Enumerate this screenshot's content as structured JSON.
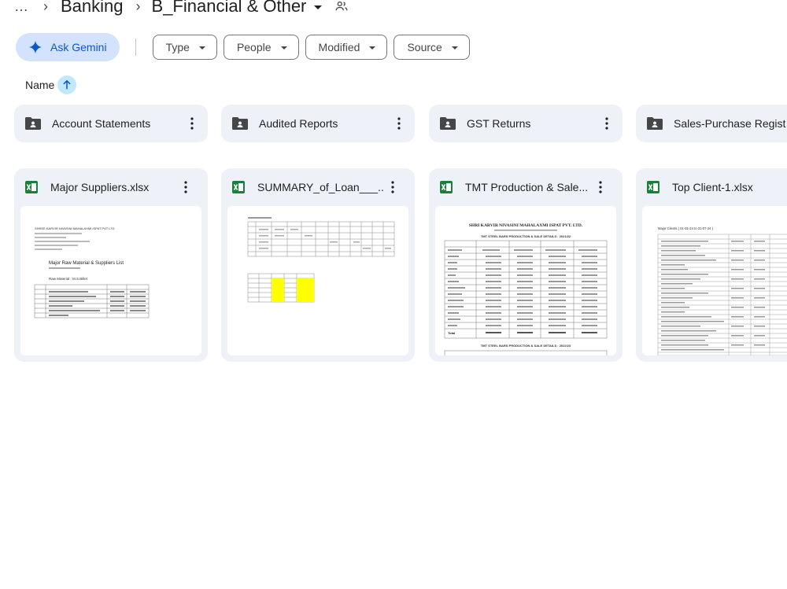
{
  "breadcrumb": {
    "more": "…",
    "items": [
      "Banking",
      "B_Financial & Other"
    ]
  },
  "filters": {
    "gemini_label": "Ask Gemini",
    "chips": [
      "Type",
      "People",
      "Modified",
      "Source"
    ]
  },
  "sort": {
    "label": "Name",
    "direction_icon": "arrow-up-icon"
  },
  "folders": [
    {
      "name": "Account Statements"
    },
    {
      "name": "Audited Reports"
    },
    {
      "name": "GST Returns"
    },
    {
      "name": "Sales-Purchase Regist"
    }
  ],
  "files": [
    {
      "name": "Major Suppliers.xlsx",
      "thumb": {
        "header": "SHREE KARVIR NIVASINI MAHALAXMI ISPAT PVT LTD",
        "title": "Major Raw Material & Suppliers List",
        "subtitle": "Raw Material : M.S.Billet"
      }
    },
    {
      "name": "SUMMARY_of_Loan___..."
    },
    {
      "name": "TMT Production & Sale...",
      "thumb": {
        "header": "SHRI KARVIR NIVASINI MAHALAXMI ISPAT PVT. LTD.",
        "title": "TMT STEEL BARS PRODUCTION & SALE DETAILS : 2021/22",
        "title2": "TMT STEEL BARS PRODUCTION & SALE DETAILS : 2022/23",
        "total_label": "Total"
      }
    },
    {
      "name": "Top Client-1.xlsx",
      "thumb": {
        "header": "Major Clients ( 01-01-24 to 31-07-24 )"
      }
    }
  ],
  "colors": {
    "accent": "#0b57d0",
    "gemini_bg": "#d3e3fd",
    "card_bg": "#eef2f8",
    "sheets_green": "#188038",
    "highlight_yellow": "#ffff00"
  }
}
